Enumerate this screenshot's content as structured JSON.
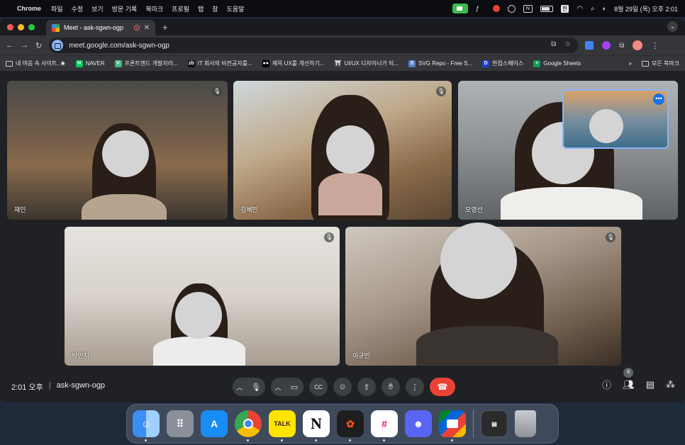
{
  "menubar": {
    "app": "Chrome",
    "items": [
      "파일",
      "수정",
      "보기",
      "방문 기록",
      "북마크",
      "프로필",
      "탭",
      "창",
      "도움말"
    ],
    "input_source": "한",
    "datetime": "8월 29일 (목) 오후 2:01"
  },
  "browser": {
    "tab_title": "Meet - ask-sgwn-ogp",
    "url": "meet.google.com/ask-sgwn-ogp",
    "bookmarks": [
      {
        "label": "내 마음 속 사이트..★",
        "icon": "folder-icon",
        "color": ""
      },
      {
        "label": "NAVER",
        "icon": "N",
        "color": "#03c75a"
      },
      {
        "label": "프론트엔드 개발자라...",
        "icon": "V",
        "color": "#42b883"
      },
      {
        "label": "IT 회사의 비전공자를...",
        "icon": "zb",
        "color": "#111111"
      },
      {
        "label": "제목 UX를 개선하기...",
        "icon": "●●",
        "color": "#000000"
      },
      {
        "label": "UI/UX 디자이너가 되...",
        "icon": "⛩",
        "color": "#444444"
      },
      {
        "label": "SVG Repo - Free S...",
        "icon": "S",
        "color": "#5a7fc1"
      },
      {
        "label": "한컴스페이스",
        "icon": "D",
        "color": "#1a3fcf"
      },
      {
        "label": "Google Sheets",
        "icon": "+",
        "color": "#0f9d58"
      }
    ],
    "all_bookmarks": "모든 북마크"
  },
  "meet": {
    "participants": [
      {
        "name": "재인"
      },
      {
        "name": "김혜민"
      },
      {
        "name": "모영선"
      },
      {
        "name": "박민지"
      },
      {
        "name": "이규빈"
      }
    ],
    "time": "2:01 오후",
    "meeting_code": "ask-sgwn-ogp",
    "people_count": "6"
  },
  "dock": {
    "apps": [
      "finder",
      "launchpad",
      "app-store",
      "chrome",
      "kakaotalk",
      "notion",
      "figma",
      "slack",
      "discord",
      "google-meet",
      "notion-window",
      "trash"
    ],
    "kakao_label": "TALK"
  },
  "colors": {
    "accent": "#8ab4f8",
    "end_call": "#ea4335",
    "control_bg": "#3c4043"
  }
}
